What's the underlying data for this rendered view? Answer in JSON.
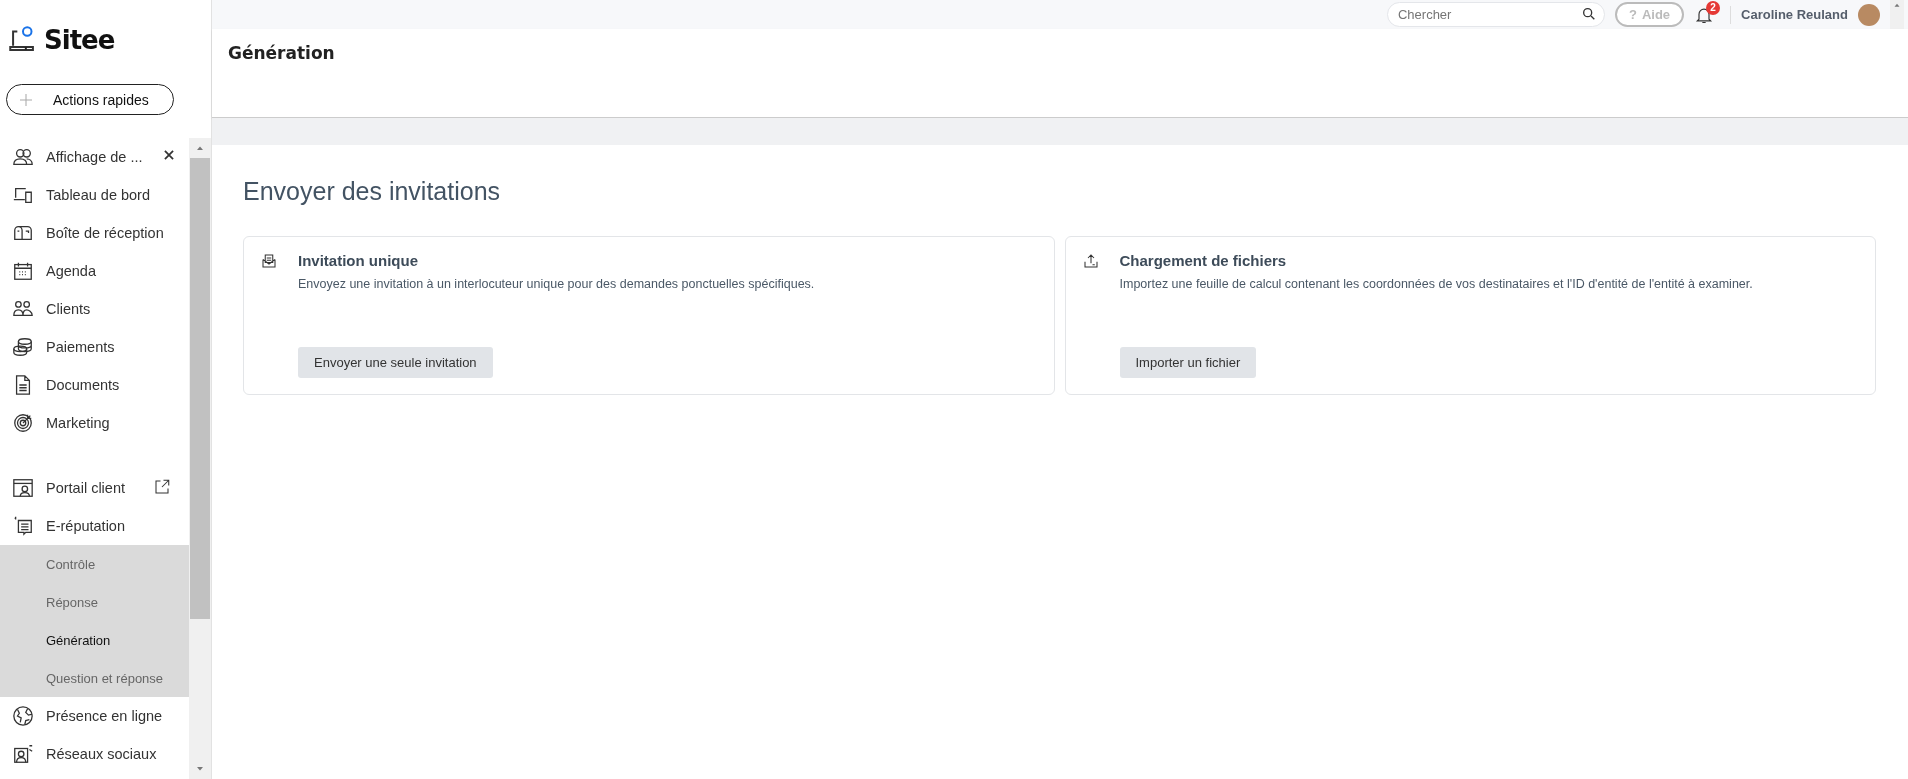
{
  "logo": {
    "text": "Sitee"
  },
  "quick_actions": {
    "label": "Actions rapides"
  },
  "nav": [
    {
      "kind": "closable",
      "label": "Affichage de ..."
    },
    {
      "kind": "link",
      "label": "Tableau de bord"
    },
    {
      "kind": "link",
      "label": "Boîte de réception"
    },
    {
      "kind": "link",
      "label": "Agenda"
    },
    {
      "kind": "link",
      "label": "Clients"
    },
    {
      "kind": "link",
      "label": "Paiements"
    },
    {
      "kind": "link",
      "label": "Documents"
    },
    {
      "kind": "link",
      "label": "Marketing"
    },
    {
      "kind": "external",
      "label": "Portail client"
    },
    {
      "kind": "group",
      "label": "E-réputation",
      "expanded": true,
      "children": [
        {
          "label": "Contrôle",
          "selected": false
        },
        {
          "label": "Réponse",
          "selected": false
        },
        {
          "label": "Génération",
          "selected": true
        },
        {
          "label": "Question et réponse",
          "selected": false
        }
      ]
    },
    {
      "kind": "link",
      "label": "Présence en ligne"
    },
    {
      "kind": "link",
      "label": "Réseaux sociaux"
    }
  ],
  "top_bar": {
    "search": {
      "placeholder": "Chercher"
    },
    "help": {
      "label": "Aide",
      "symbol": "?"
    },
    "notifications": {
      "count": "2"
    },
    "user": {
      "name": "Caroline Reuland"
    }
  },
  "header": {
    "title": "Génération"
  },
  "page": {
    "title": "Envoyer des invitations",
    "cards": [
      {
        "kind": "single",
        "title": "Invitation unique",
        "description": "Envoyez une invitation à un interlocuteur unique pour des demandes ponctuelles spécifiques.",
        "button": "Envoyer une seule invitation"
      },
      {
        "kind": "upload",
        "title": "Chargement de fichiers",
        "description": "Importez une feuille de calcul contenant les coordonnées de vos destinataires et l'ID d'entité de l'entité à examiner.",
        "button": "Importer un fichier"
      }
    ]
  }
}
